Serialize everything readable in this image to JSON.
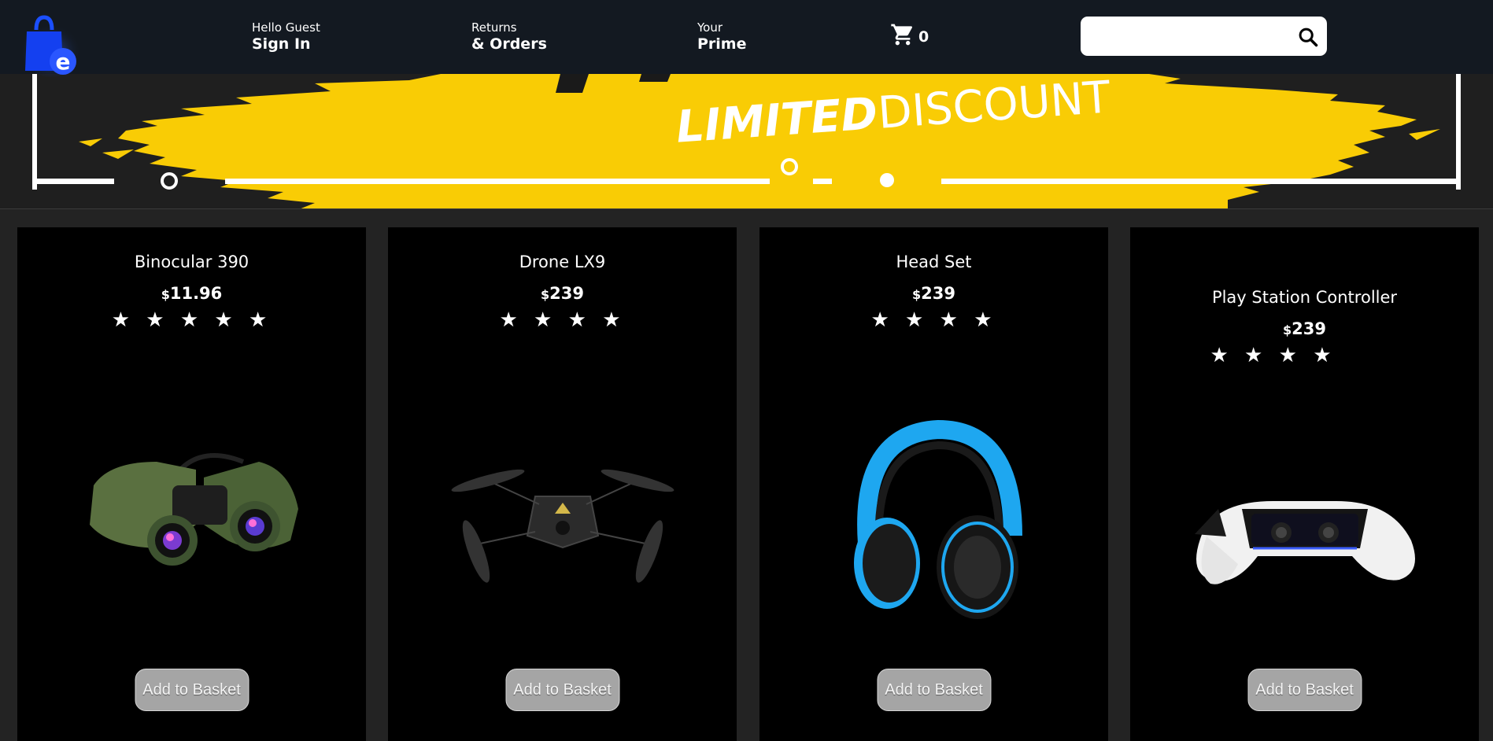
{
  "header": {
    "logo_icon": "shopping-bag-e-icon",
    "nav": [
      {
        "line1": "Hello Guest",
        "line2": "Sign In"
      },
      {
        "line1": "Returns",
        "line2": "& Orders"
      },
      {
        "line1": "Your",
        "line2": "Prime"
      }
    ],
    "basket": {
      "icon": "cart-icon",
      "count": "0"
    },
    "search": {
      "value": "",
      "placeholder": "",
      "icon": "search-icon"
    }
  },
  "banner": {
    "headline_bold": "LIMITED",
    "headline_light": "DISCOUNT",
    "colors": {
      "brush": "#f9cc05",
      "frame": "#ffffff",
      "background": "#1f1f1f"
    }
  },
  "products": [
    {
      "title": "Binocular 390",
      "currency": "$",
      "price": "11.96",
      "rating": 5,
      "stars": "★ ★ ★ ★ ★",
      "image": "binoculars-image",
      "button": "Add to Basket"
    },
    {
      "title": "Drone LX9",
      "currency": "$",
      "price": "239",
      "rating": 4,
      "stars": "★ ★ ★ ★",
      "image": "drone-image",
      "button": "Add to Basket"
    },
    {
      "title": "Head Set",
      "currency": "$",
      "price": "239",
      "rating": 4,
      "stars": "★ ★ ★ ★",
      "image": "headset-image",
      "button": "Add to Basket"
    },
    {
      "title": "Play Station Controller",
      "currency": "$",
      "price": "239",
      "rating": 4,
      "stars": "★ ★ ★ ★",
      "image": "game-controller-image",
      "button": "Add to Basket"
    }
  ]
}
